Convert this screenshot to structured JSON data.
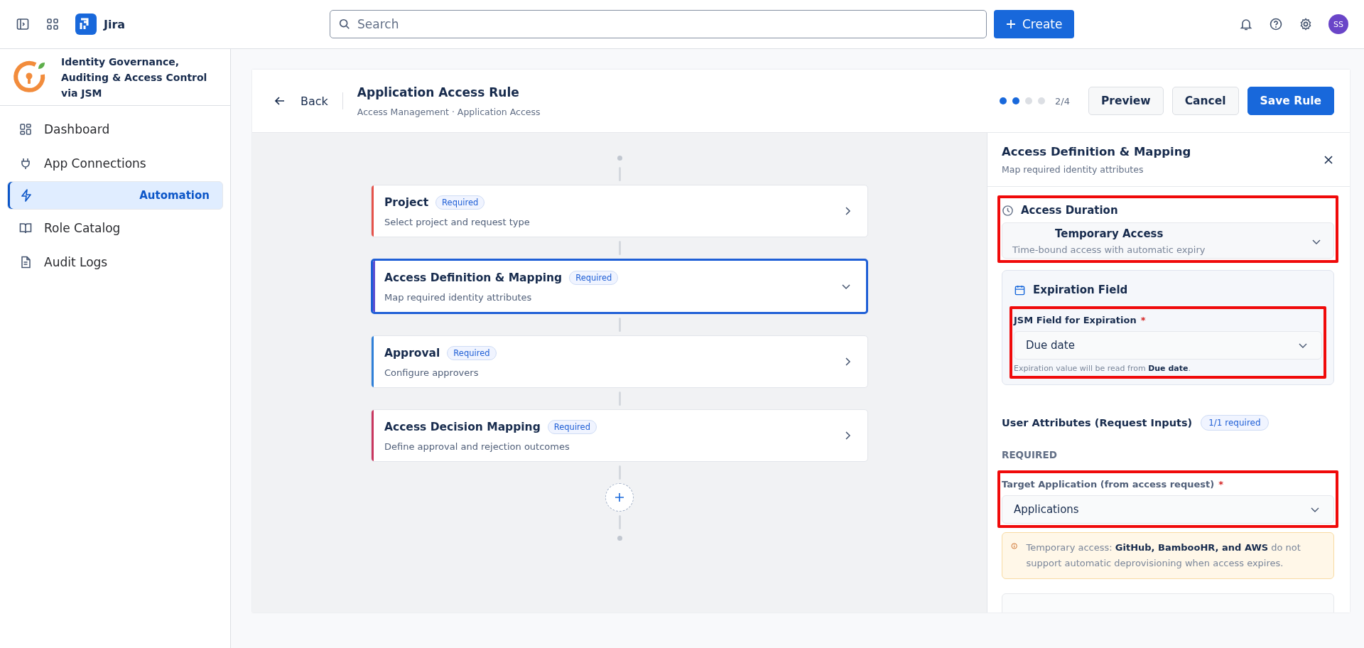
{
  "topbar": {
    "app_name": "Jira",
    "search": {
      "placeholder": "Search"
    },
    "create_button": "Create",
    "avatar": "SS"
  },
  "sidebar": {
    "title": "Identity Governance, Auditing & Access Control via JSM",
    "items": [
      {
        "label": "Dashboard",
        "selected": false
      },
      {
        "label": "App Connections",
        "selected": false
      },
      {
        "label": "Automation",
        "selected": true
      },
      {
        "label": "Role Catalog",
        "selected": false
      },
      {
        "label": "Audit Logs",
        "selected": false
      }
    ]
  },
  "header": {
    "back": "Back",
    "title": "Application Access Rule",
    "breadcrumb": "Access Management · Application Access",
    "steps": [
      {
        "done": true
      },
      {
        "done": true
      },
      {
        "done": false
      },
      {
        "done": false
      }
    ],
    "step_label": "2/4",
    "buttons": [
      {
        "label": "Preview",
        "kind": "secondary"
      },
      {
        "label": "Cancel",
        "kind": "secondary"
      },
      {
        "label": "Save Rule",
        "kind": "primary"
      }
    ]
  },
  "flow": {
    "cards": [
      {
        "title": "Project",
        "badge": "Required",
        "subtitle": "Select project and request type",
        "color": "#e5534b",
        "expanded": false
      },
      {
        "title": "Access Definition & Mapping",
        "badge": "Required",
        "subtitle": "Map required identity attributes",
        "color": "#5b4fd1",
        "expanded": true
      },
      {
        "title": "Approval",
        "badge": "Required",
        "subtitle": "Configure approvers",
        "color": "#2f80d8",
        "expanded": false
      },
      {
        "title": "Access Decision Mapping",
        "badge": "Required",
        "subtitle": "Define approval and rejection outcomes",
        "color": "#c9375f",
        "expanded": false
      }
    ]
  },
  "panel": {
    "title": "Access Definition & Mapping",
    "subtitle": "Map required identity attributes",
    "duration": {
      "label": "Access Duration",
      "value": "Temporary Access",
      "description": "Time-bound access with automatic expiry",
      "highlighted": true
    },
    "expiration": {
      "title": "Expiration Field",
      "field_label": "JSM Field for Expiration",
      "required_mark": "*",
      "value": "Due date",
      "hint": "Expiration value will be read from **Due date**.",
      "highlighted": true
    },
    "attributes": {
      "title": "User Attributes (Request Inputs)",
      "badge": "1/1 required",
      "group_label": "REQUIRED",
      "target": {
        "label": "Target Application (from access request)",
        "required_mark": "*",
        "value": "Applications",
        "highlighted": true
      },
      "warning": "Temporary access: **GitHub, BambooHR, and AWS** do not support automatic deprovisioning when access expires."
    }
  }
}
